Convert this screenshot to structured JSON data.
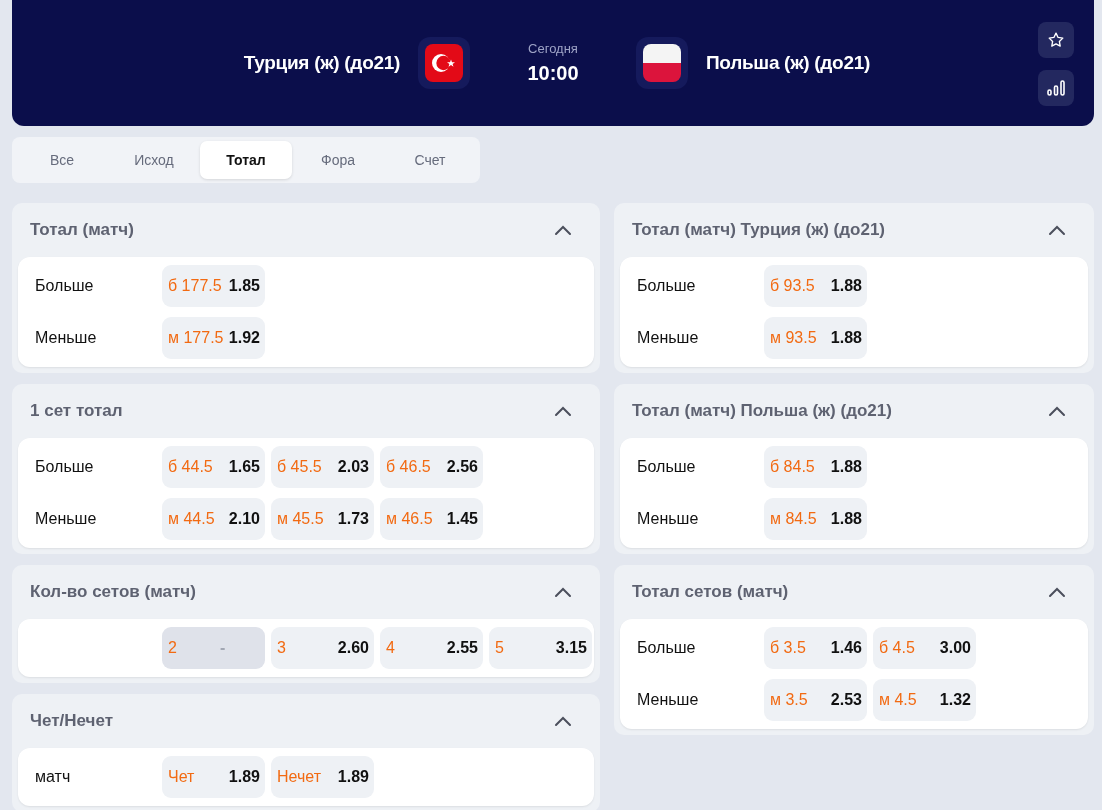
{
  "match": {
    "home": "Турция (ж) (до21)",
    "away": "Польша (ж) (до21)",
    "day": "Сегодня",
    "time": "10:00",
    "favorite": false
  },
  "tabs": [
    {
      "label": "Все",
      "selected": false
    },
    {
      "label": "Исход",
      "selected": false
    },
    {
      "label": "Тотал",
      "selected": true
    },
    {
      "label": "Фора",
      "selected": false
    },
    {
      "label": "Счет",
      "selected": false
    }
  ],
  "columns": [
    [
      {
        "title": "Тотал (матч)",
        "expanded": true,
        "rows": [
          {
            "label": "Больше",
            "odds": [
              {
                "outcome": "б 177.5",
                "price": "1.85",
                "disabled": false
              }
            ]
          },
          {
            "label": "Меньше",
            "odds": [
              {
                "outcome": "м 177.5",
                "price": "1.92",
                "disabled": false
              }
            ]
          }
        ]
      },
      {
        "title": "1 сет тотал",
        "expanded": true,
        "rows": [
          {
            "label": "Больше",
            "odds": [
              {
                "outcome": "б 44.5",
                "price": "1.65",
                "disabled": false
              },
              {
                "outcome": "б 45.5",
                "price": "2.03",
                "disabled": false
              },
              {
                "outcome": "б 46.5",
                "price": "2.56",
                "disabled": false
              }
            ]
          },
          {
            "label": "Меньше",
            "odds": [
              {
                "outcome": "м 44.5",
                "price": "2.10",
                "disabled": false
              },
              {
                "outcome": "м 45.5",
                "price": "1.73",
                "disabled": false
              },
              {
                "outcome": "м 46.5",
                "price": "1.45",
                "disabled": false
              }
            ]
          }
        ]
      },
      {
        "title": "Кол-во сетов (матч)",
        "expanded": true,
        "rows": [
          {
            "odds": [
              {
                "outcome": "2",
                "price": "-",
                "disabled": true
              },
              {
                "outcome": "3",
                "price": "2.60",
                "disabled": false
              },
              {
                "outcome": "4",
                "price": "2.55",
                "disabled": false
              },
              {
                "outcome": "5",
                "price": "3.15",
                "disabled": false
              }
            ]
          }
        ]
      },
      {
        "title": "Чет/Нечет",
        "expanded": true,
        "rows": [
          {
            "label": "матч",
            "odds": [
              {
                "outcome": "Чет",
                "price": "1.89",
                "disabled": false
              },
              {
                "outcome": "Нечет",
                "price": "1.89",
                "disabled": false
              }
            ]
          }
        ]
      }
    ],
    [
      {
        "title": "Тотал (матч) Турция (ж) (до21)",
        "expanded": true,
        "rows": [
          {
            "label": "Больше",
            "odds": [
              {
                "outcome": "б 93.5",
                "price": "1.88",
                "disabled": false
              }
            ]
          },
          {
            "label": "Меньше",
            "odds": [
              {
                "outcome": "м 93.5",
                "price": "1.88",
                "disabled": false
              }
            ]
          }
        ]
      },
      {
        "title": "Тотал (матч) Польша (ж) (до21)",
        "expanded": true,
        "rows": [
          {
            "label": "Больше",
            "odds": [
              {
                "outcome": "б 84.5",
                "price": "1.88",
                "disabled": false
              }
            ]
          },
          {
            "label": "Меньше",
            "odds": [
              {
                "outcome": "м 84.5",
                "price": "1.88",
                "disabled": false
              }
            ]
          }
        ]
      },
      {
        "title": "Тотал сетов (матч)",
        "expanded": true,
        "rows": [
          {
            "label": "Больше",
            "odds": [
              {
                "outcome": "б 3.5",
                "price": "1.46",
                "disabled": false
              },
              {
                "outcome": "б 4.5",
                "price": "3.00",
                "disabled": false
              }
            ]
          },
          {
            "label": "Меньше",
            "odds": [
              {
                "outcome": "м 3.5",
                "price": "2.53",
                "disabled": false
              },
              {
                "outcome": "м 4.5",
                "price": "1.32",
                "disabled": false
              }
            ]
          }
        ]
      }
    ]
  ]
}
